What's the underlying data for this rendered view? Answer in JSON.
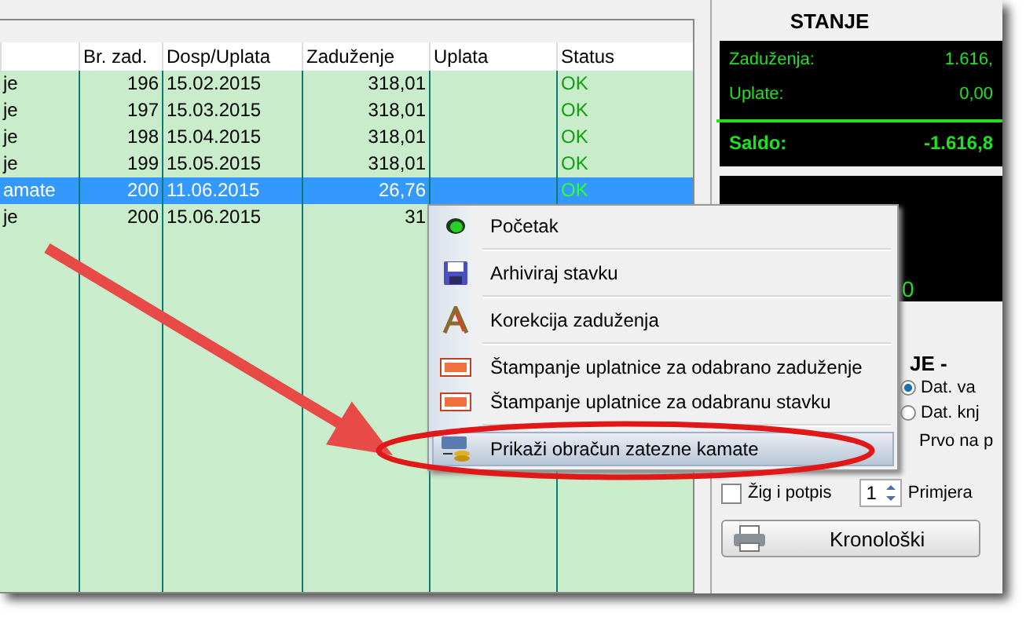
{
  "table": {
    "columns": [
      "Br. zad.",
      "Dosp/Uplata",
      "Zaduženje",
      "Uplata",
      "Status"
    ],
    "rows": [
      {
        "column_1": "je",
        "number": "196",
        "date": "15.02.2015",
        "charge": "318,01",
        "status": "OK",
        "selected": false
      },
      {
        "column_1": "je",
        "number": "197",
        "date": "15.03.2015",
        "charge": "318,01",
        "status": "OK",
        "selected": false
      },
      {
        "column_1": "je",
        "number": "198",
        "date": "15.04.2015",
        "charge": "318,01",
        "status": "OK",
        "selected": false
      },
      {
        "column_1": "je",
        "number": "199",
        "date": "15.05.2015",
        "charge": "318,01",
        "status": "OK",
        "selected": false
      },
      {
        "column_1": "amate",
        "number": "200",
        "date": "11.06.2015",
        "charge": "26,76",
        "status": "OK",
        "selected": true
      },
      {
        "column_1": "je",
        "number": "200",
        "date": "15.06.2015",
        "charge": "31",
        "selected": false
      }
    ]
  },
  "balance": {
    "title": "STANJE",
    "lines": [
      {
        "label": "Zaduženja:",
        "value": "1.616,"
      },
      {
        "label": "Uplate:",
        "value": "0,00"
      }
    ],
    "total": {
      "label": "Saldo:",
      "value": "-1.616,8"
    },
    "extra_value": "0"
  },
  "options": {
    "group_title": "JE -",
    "radios": [
      {
        "label": "Dat. va",
        "selected": true
      },
      {
        "label": "Dat. knj",
        "selected": false
      }
    ],
    "first_label": "Prvo na p",
    "stamp": {
      "label": "Žig i potpis",
      "checked": false
    },
    "copies": {
      "value": "1",
      "label": "Primjera"
    },
    "button": "Kronološki"
  },
  "context_menu": {
    "items": [
      {
        "label": "Početak",
        "selected": false
      },
      {
        "label": "Arhiviraj stavku",
        "selected": false
      },
      {
        "label": "Korekcija zaduženja",
        "selected": false
      },
      {
        "label": "Štampanje uplatnice za odabrano zaduženje",
        "selected": false
      },
      {
        "label": "Štampanje uplatnice za odabranu stavku",
        "selected": false
      },
      {
        "label": "Prikaži obračun zatezne kamate",
        "selected": true
      }
    ]
  }
}
